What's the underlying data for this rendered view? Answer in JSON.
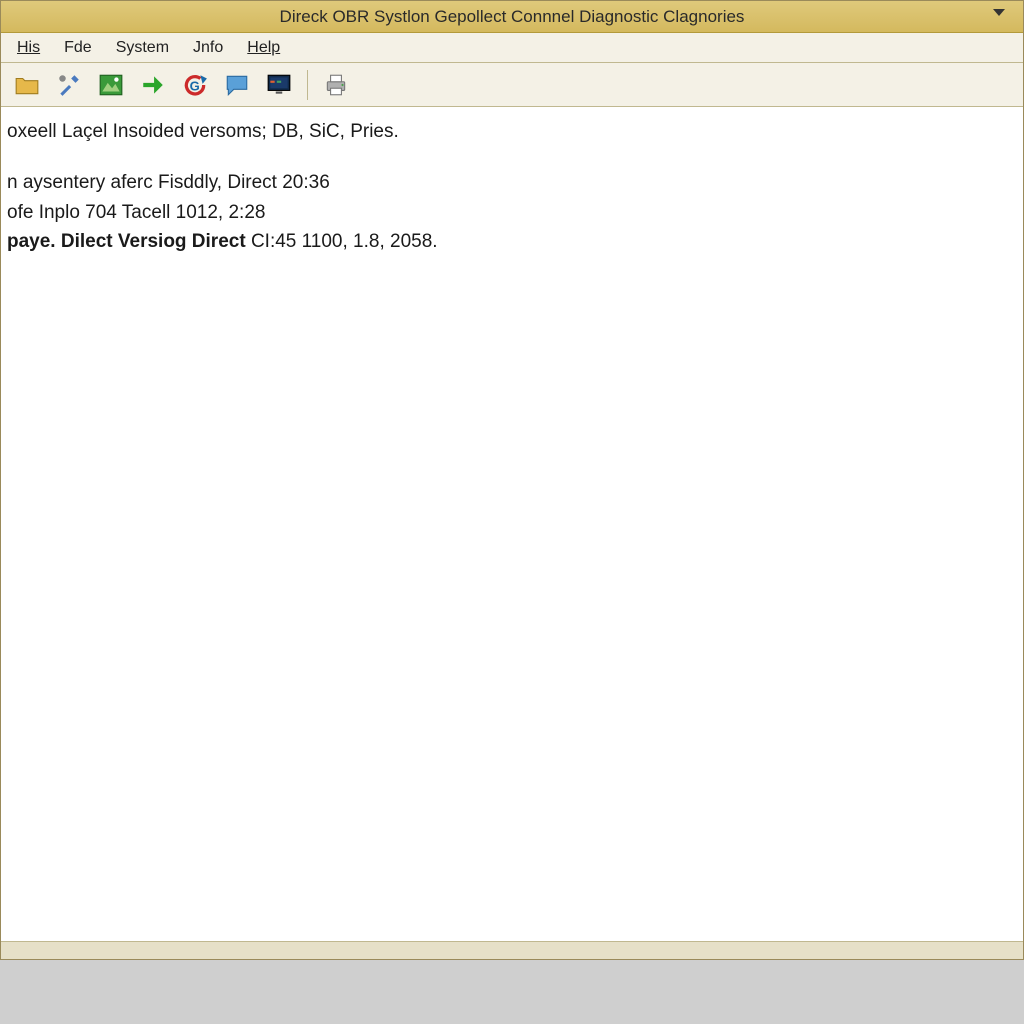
{
  "window": {
    "title": "Direck OBR Systlon Gepollect Connnel Diagnostic Clagnories"
  },
  "menubar": {
    "items": [
      {
        "label": "His"
      },
      {
        "label": "Fde"
      },
      {
        "label": "System"
      },
      {
        "label": "Jnfo"
      },
      {
        "label": "Help"
      }
    ]
  },
  "toolbar": {
    "icons": [
      "folder-icon",
      "tools-icon",
      "image-icon",
      "arrow-right-icon",
      "refresh-g-icon",
      "chat-icon",
      "monitor-icon",
      "print-icon"
    ]
  },
  "content": {
    "line1": "oxeell Laçel Insoided versoms; DB, SiC, Pries.",
    "line2": "n aysentery aferc Fisddly, Direct 20:36",
    "line3": "ofe Inplo 704 Tacell  1012, 2:28",
    "line4_bold": "paye. Dilect Versiog Direct",
    "line4_rest": " CI:45 1100, 1.8, 2058."
  }
}
